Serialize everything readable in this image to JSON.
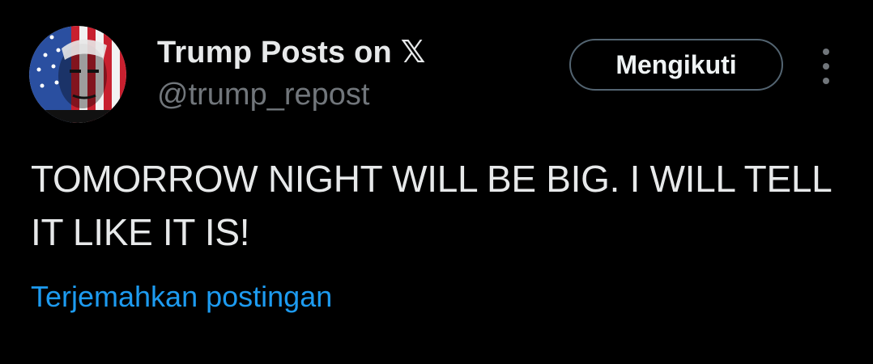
{
  "author": {
    "display_name": "Trump Posts on 𝕏",
    "handle": "@trump_repost",
    "avatar_icon": "flag-portrait-avatar"
  },
  "actions": {
    "follow_label": "Mengikuti",
    "more_icon": "more-vertical-icon"
  },
  "post": {
    "text": "TOMORROW NIGHT WILL BE BIG. I WILL TELL IT LIKE IT IS!",
    "translate_label": "Terjemahkan postingan"
  },
  "colors": {
    "background": "#000000",
    "primary_text": "#e7e9ea",
    "secondary_text": "#71767b",
    "link": "#1d9bf0",
    "button_border": "#536471"
  }
}
